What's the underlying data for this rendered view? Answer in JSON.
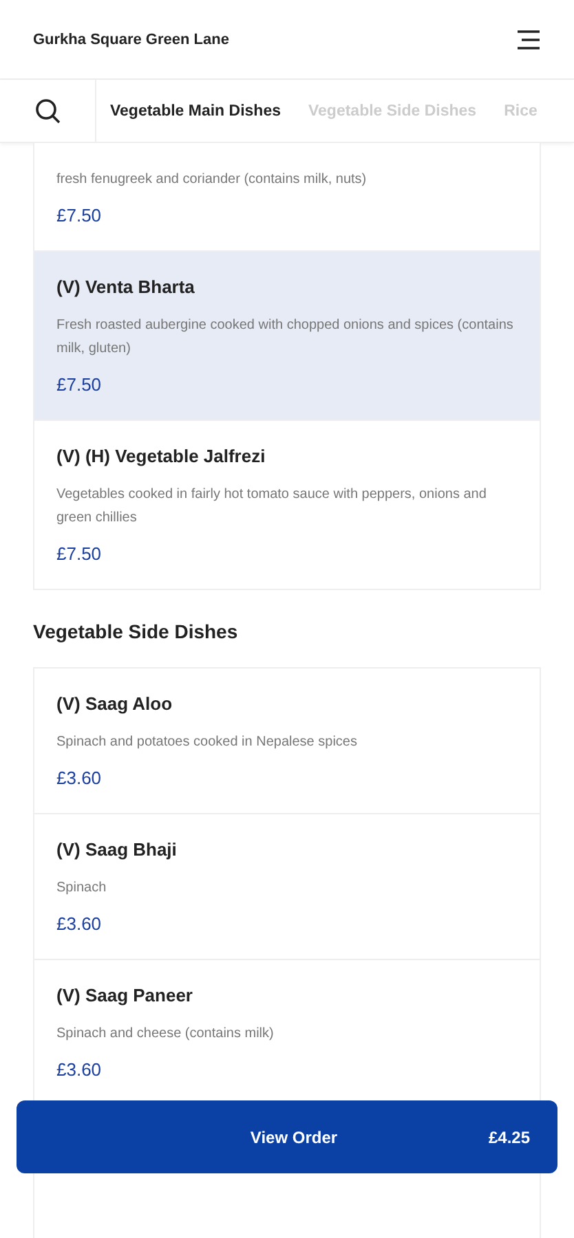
{
  "header": {
    "title": "Gurkha Square Green Lane"
  },
  "tabs": [
    {
      "label": "Vegetable Main Dishes",
      "selected": true
    },
    {
      "label": "Vegetable Side Dishes",
      "selected": false
    },
    {
      "label": "Rice",
      "selected": false
    }
  ],
  "sections": [
    {
      "items": [
        {
          "description": "fresh fenugreek and coriander (contains milk, nuts)",
          "price": "£7.50",
          "selected": false
        },
        {
          "name": "(V) Venta Bharta",
          "description": "Fresh roasted aubergine cooked with chopped onions and spices (contains milk, gluten)",
          "price": "£7.50",
          "selected": true
        },
        {
          "name": "(V) (H) Vegetable Jalfrezi",
          "description": "Vegetables cooked in fairly hot tomato sauce with peppers, onions and green chillies",
          "price": "£7.50",
          "selected": false
        }
      ]
    },
    {
      "title": "Vegetable Side Dishes",
      "items": [
        {
          "name": "(V) Saag Aloo",
          "description": "Spinach and potatoes cooked in Nepalese spices",
          "price": "£3.60",
          "selected": false
        },
        {
          "name": "(V) Saag Bhaji",
          "description": "Spinach",
          "price": "£3.60",
          "selected": false
        },
        {
          "name": "(V) Saag Paneer",
          "description": "Spinach and cheese (contains milk)",
          "price": "£3.60",
          "selected": false
        }
      ]
    }
  ],
  "order_button": {
    "label": "View Order",
    "total": "£4.25"
  }
}
